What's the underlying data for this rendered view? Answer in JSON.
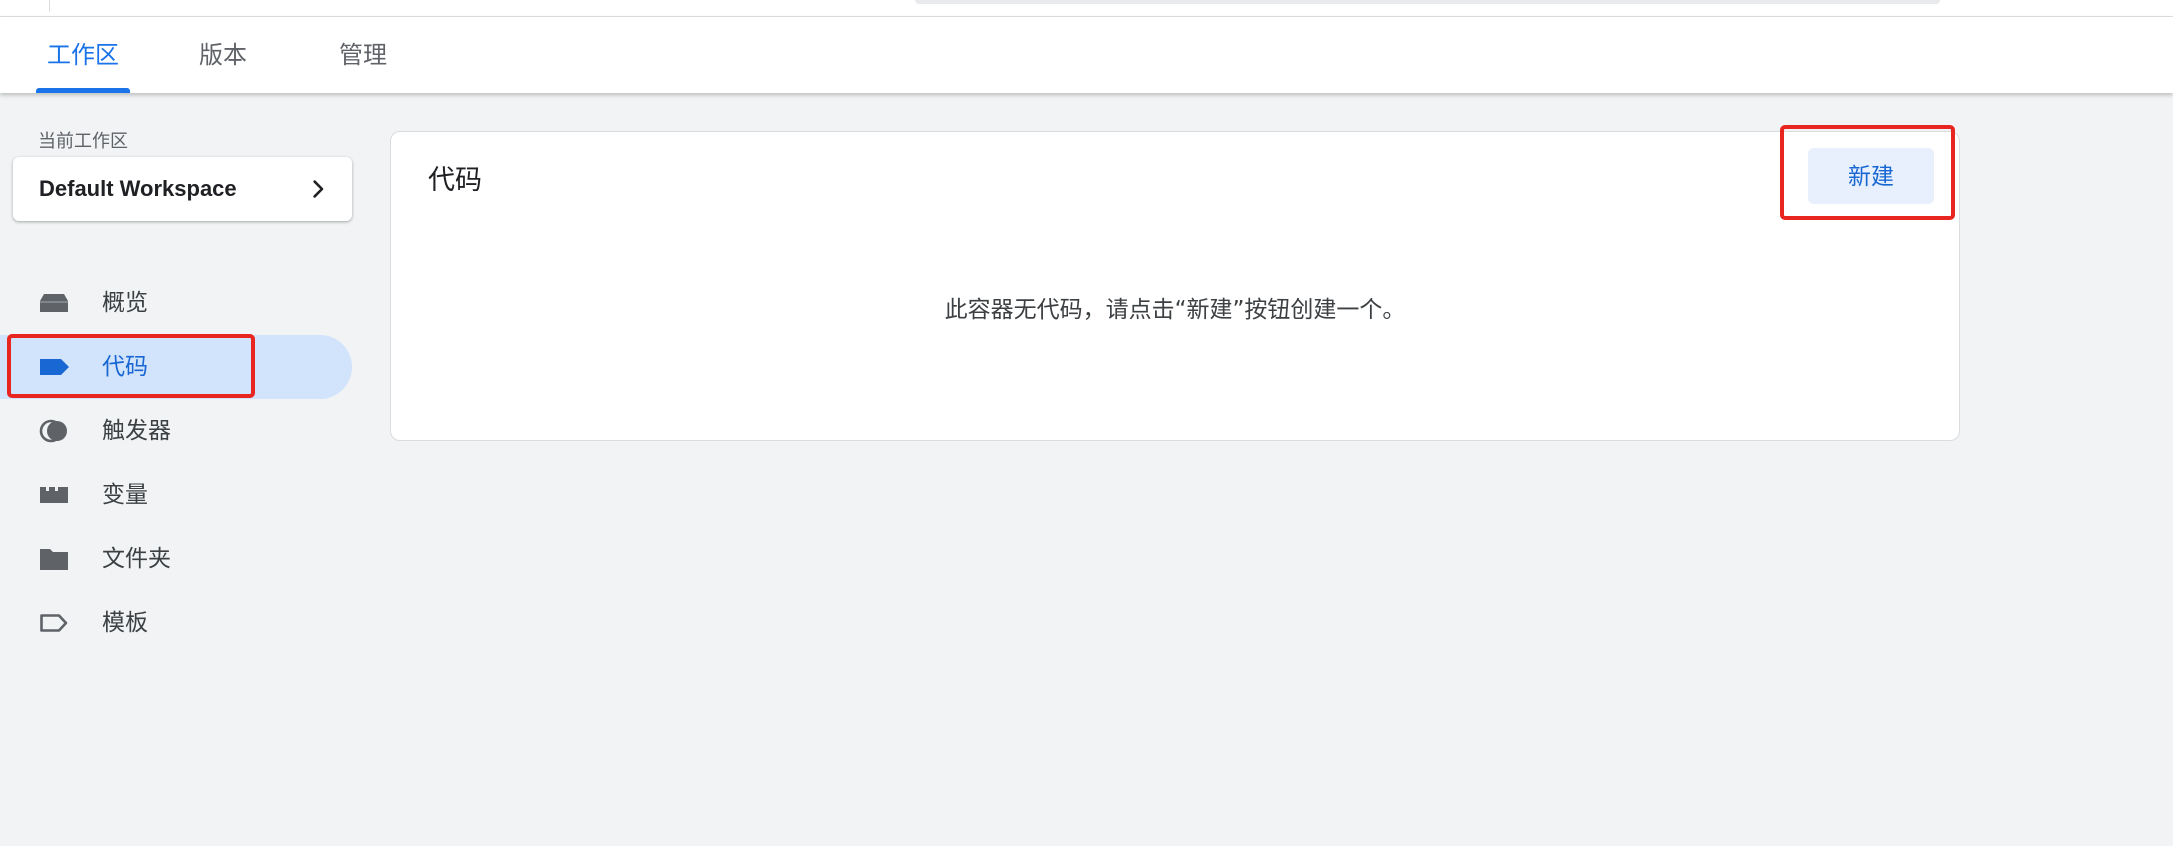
{
  "tabs": [
    {
      "label": "工作区",
      "active": true
    },
    {
      "label": "版本",
      "active": false
    },
    {
      "label": "管理",
      "active": false
    }
  ],
  "workspace": {
    "section_label": "当前工作区",
    "name": "Default Workspace"
  },
  "nav": {
    "items": [
      {
        "label": "概览",
        "icon": "overview-icon"
      },
      {
        "label": "代码",
        "icon": "tag-icon",
        "active": true
      },
      {
        "label": "触发器",
        "icon": "trigger-icon"
      },
      {
        "label": "变量",
        "icon": "variable-icon"
      },
      {
        "label": "文件夹",
        "icon": "folder-icon"
      },
      {
        "label": "模板",
        "icon": "template-icon"
      }
    ]
  },
  "main": {
    "card_title": "代码",
    "new_button_label": "新建",
    "empty_message": "此容器无代码，请点击“新建”按钮创建一个。"
  },
  "colors": {
    "accent": "#1a73e8",
    "active_bg": "#d2e3fc",
    "highlight": "#e8261f"
  }
}
